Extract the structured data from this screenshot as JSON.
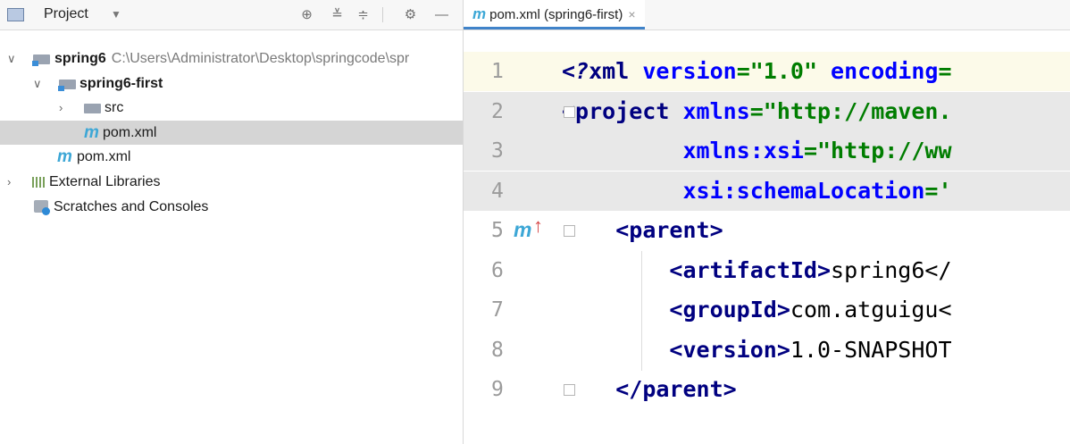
{
  "project_panel": {
    "title": "Project",
    "tree": [
      {
        "name": "spring6",
        "path": "C:\\Users\\Administrator\\Desktop\\springcode\\spr"
      },
      {
        "name": "spring6-first"
      },
      {
        "name": "src"
      },
      {
        "name": "pom.xml"
      },
      {
        "name": "pom.xml"
      },
      {
        "name": "External Libraries"
      },
      {
        "name": "Scratches and Consoles"
      }
    ]
  },
  "editor": {
    "tab_label": "pom.xml (spring6-first)",
    "tab_close": "×",
    "lines": [
      {
        "num": "1",
        "parts": [
          [
            "pi",
            "<?"
          ],
          [
            "tag",
            "xml "
          ],
          [
            "attr",
            "version"
          ],
          [
            "",
            ""
          ],
          [
            "aval",
            "=\"1.0\" "
          ],
          [
            "attr",
            "encoding"
          ],
          [
            "aval",
            "="
          ]
        ]
      },
      {
        "num": "2",
        "parts": [
          [
            "tag",
            "<project "
          ],
          [
            "attr",
            "xmlns"
          ],
          [
            "aval",
            "=\"http://maven."
          ]
        ]
      },
      {
        "num": "3",
        "parts": [
          [
            "",
            "         "
          ],
          [
            "attr",
            "xmlns:xsi"
          ],
          [
            "aval",
            "=\"http://ww"
          ]
        ]
      },
      {
        "num": "4",
        "parts": [
          [
            "",
            "         "
          ],
          [
            "attr",
            "xsi:schemaLocation"
          ],
          [
            "aval",
            "='"
          ]
        ]
      },
      {
        "num": "5",
        "parts": [
          [
            "",
            "    "
          ],
          [
            "tag",
            "<parent>"
          ]
        ]
      },
      {
        "num": "6",
        "parts": [
          [
            "",
            "        "
          ],
          [
            "tag",
            "<artifactId>"
          ],
          [
            "",
            "spring6</"
          ]
        ]
      },
      {
        "num": "7",
        "parts": [
          [
            "",
            "        "
          ],
          [
            "tag",
            "<groupId>"
          ],
          [
            "",
            "com.atguigu<"
          ]
        ]
      },
      {
        "num": "8",
        "parts": [
          [
            "",
            "        "
          ],
          [
            "tag",
            "<version>"
          ],
          [
            "",
            "1.0-SNAPSHOT"
          ]
        ]
      },
      {
        "num": "9",
        "parts": [
          [
            "",
            "    "
          ],
          [
            "tag",
            "</parent>"
          ]
        ]
      }
    ]
  },
  "colors": {
    "accent": "#4083c9",
    "maven_icon": "#3da7d6",
    "selection": "#d5d5d5"
  }
}
